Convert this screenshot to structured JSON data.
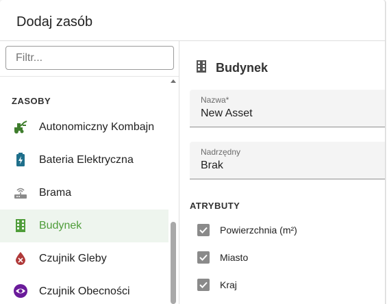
{
  "dialog": {
    "title": "Dodaj zasób"
  },
  "filter": {
    "placeholder": "Filtr...",
    "value": ""
  },
  "list": {
    "section_label": "ZASOBY",
    "items": [
      {
        "label": "Autonomiczny Kombajn",
        "icon": "harvester-icon",
        "color": "#3f7d2d"
      },
      {
        "label": "Bateria Elektryczna",
        "icon": "battery-icon",
        "color": "#1f6f8b"
      },
      {
        "label": "Brama",
        "icon": "router-icon",
        "color": "#8a8a8a"
      },
      {
        "label": "Budynek",
        "icon": "building-icon",
        "color": "#4f9d3a",
        "selected": true
      },
      {
        "label": "Czujnik Gleby",
        "icon": "soil-sensor-icon",
        "color": "#b03a3a"
      },
      {
        "label": "Czujnik Obecności",
        "icon": "eye-icon",
        "color": "#6a1b9a"
      }
    ]
  },
  "detail": {
    "title": "Budynek",
    "name_label": "Nazwa*",
    "name_value": "New Asset",
    "parent_label": "Nadrzędny",
    "parent_value": "Brak",
    "attributes_label": "ATRYBUTY",
    "attributes": [
      {
        "label": "Powierzchnia (m²)",
        "checked": true
      },
      {
        "label": "Miasto",
        "checked": true
      },
      {
        "label": "Kraj",
        "checked": true
      }
    ]
  },
  "colors": {
    "accent": "#4f9d3a",
    "selected_bg": "#eef5ee"
  }
}
